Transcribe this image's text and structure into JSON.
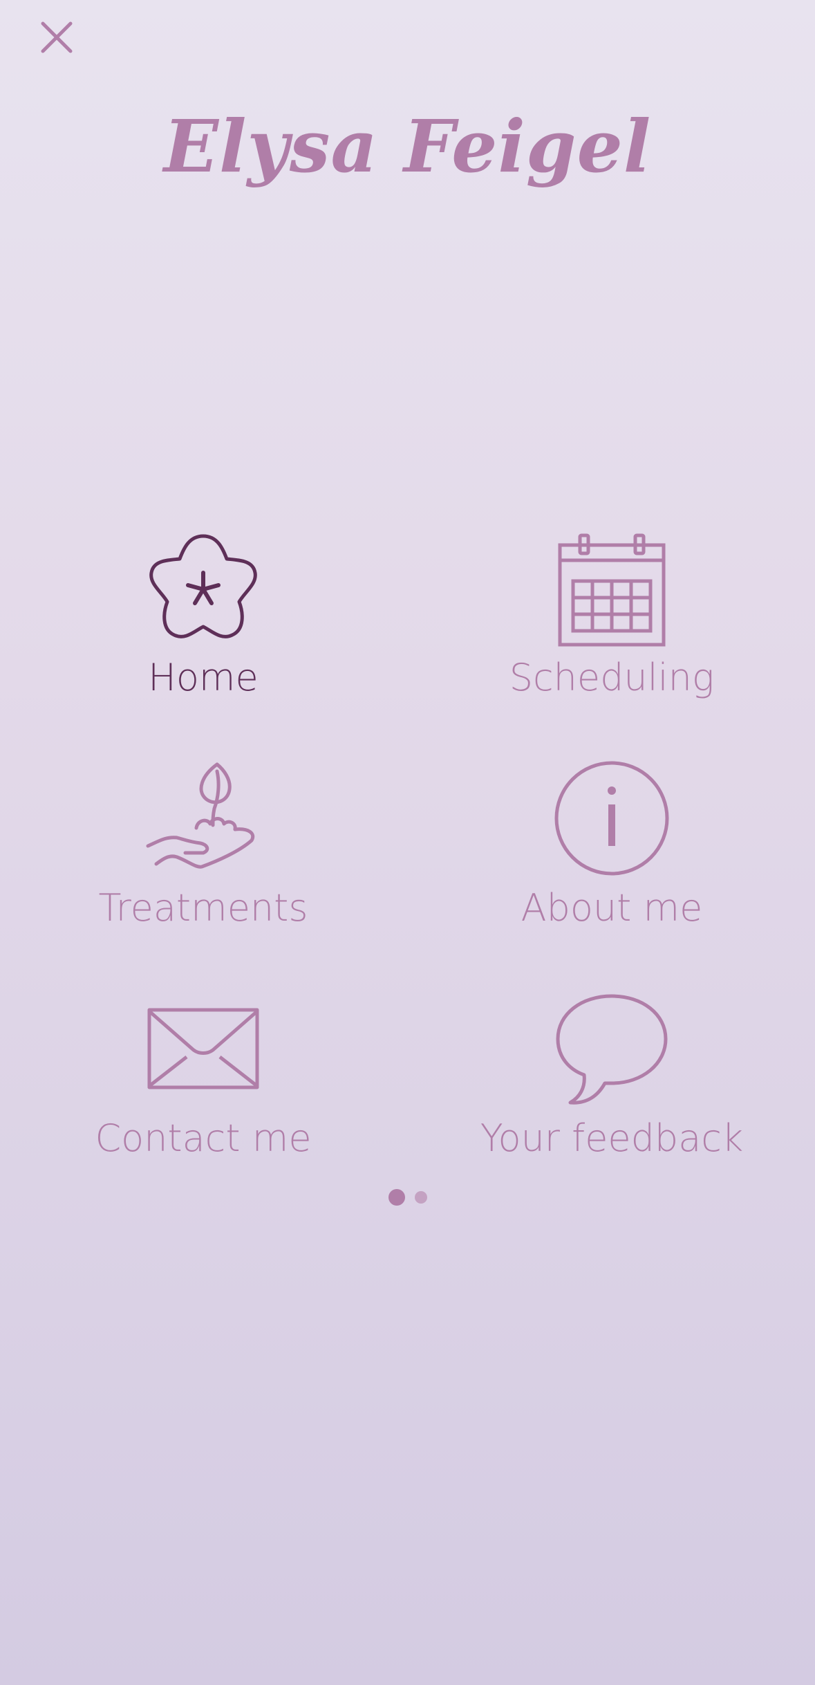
{
  "header": {
    "close_label": "close",
    "brand_title": "Elysa Feigel"
  },
  "menu": {
    "items": [
      {
        "id": "home",
        "label": "Home",
        "icon": "flower-icon",
        "active": true
      },
      {
        "id": "scheduling",
        "label": "Scheduling",
        "icon": "calendar-icon",
        "active": false
      },
      {
        "id": "treatments",
        "label": "Treatments",
        "icon": "hand-leaf-icon",
        "active": false
      },
      {
        "id": "about",
        "label": "About me",
        "icon": "info-icon",
        "active": false
      },
      {
        "id": "contact",
        "label": "Contact me",
        "icon": "envelope-icon",
        "active": false
      },
      {
        "id": "feedback",
        "label": "Your feedback",
        "icon": "speech-bubble-icon",
        "active": false
      }
    ]
  },
  "pager": {
    "page_count": 2,
    "current_page": 1
  },
  "colors": {
    "accent": "#b07ea8",
    "active": "#5e2f58",
    "background_top": "#e8e3ef",
    "background_bottom": "#d4cbe2"
  }
}
